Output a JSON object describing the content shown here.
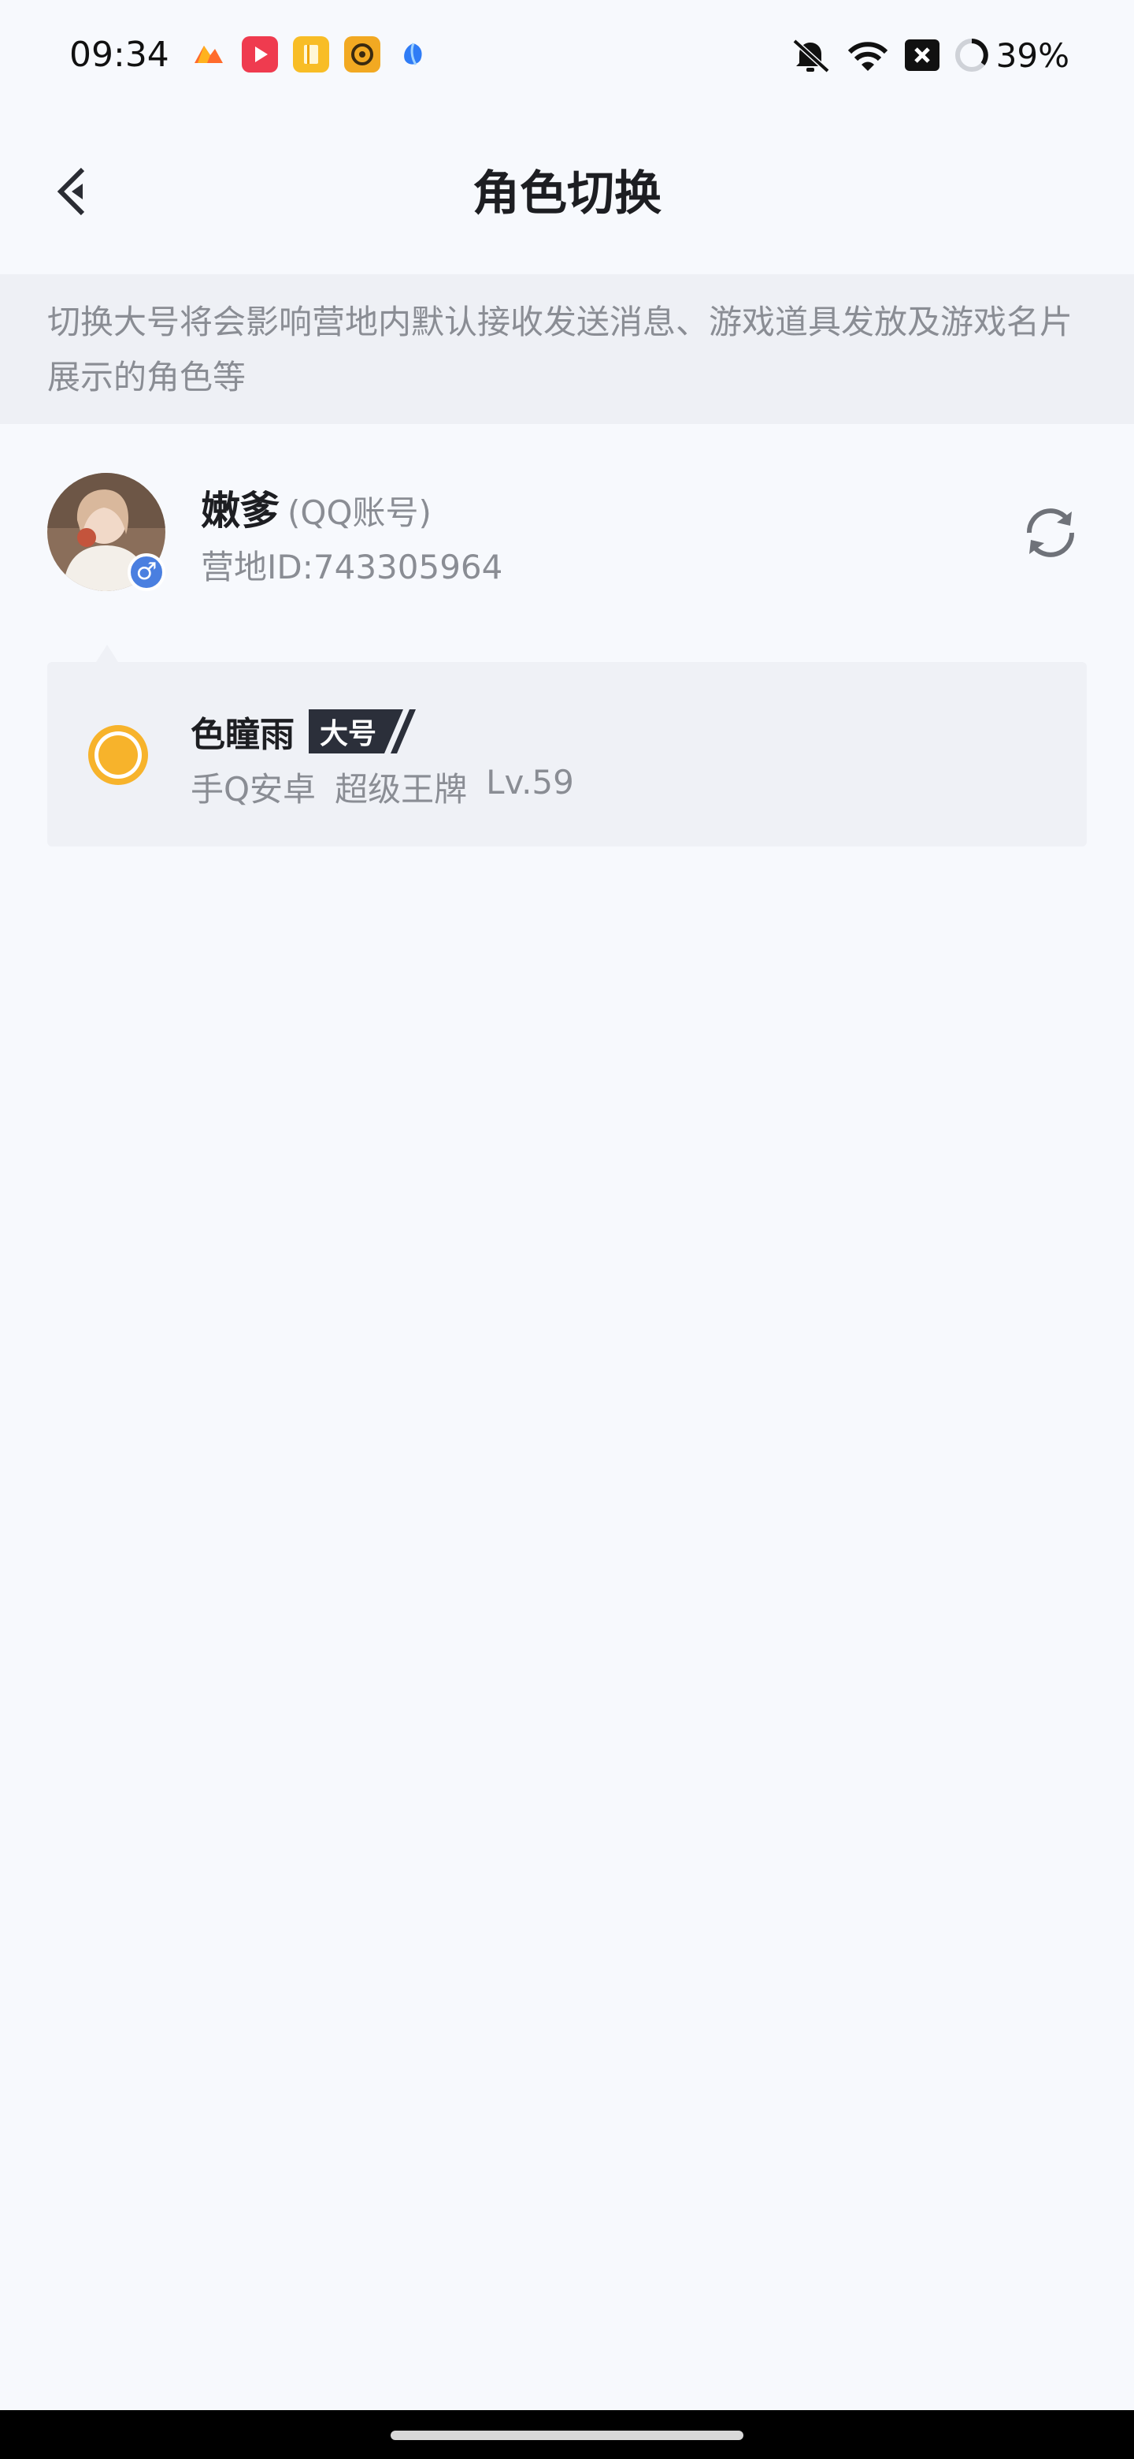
{
  "status_bar": {
    "time": "09:34",
    "app_icons": [
      "app-icon-1",
      "video-icon",
      "book-icon",
      "music-icon",
      "app-icon-5"
    ],
    "system_icons": [
      "mute-icon",
      "wifi-icon",
      "close-box-icon",
      "battery-ring-icon"
    ],
    "battery": "39%"
  },
  "nav": {
    "title": "角色切换",
    "back_icon": "chevron-left-icon"
  },
  "notice": {
    "text": "切换大号将会影响营地内默认接收发送消息、游戏道具发放及游戏名片展示的角色等"
  },
  "account": {
    "name": "嫩爹",
    "type": "(QQ账号)",
    "id": "营地ID:743305964",
    "gender_symbol": "♂",
    "refresh_icon": "refresh-icon"
  },
  "role": {
    "name": "色瞳雨",
    "tag": "大号",
    "platform": "手Q安卓",
    "rank": "超级王牌",
    "level": "Lv.59",
    "selected": true
  },
  "colors": {
    "background": "#f7f9fd",
    "notice_bg": "#eef0f5",
    "card_bg": "#eff1f6",
    "accent": "#f7b32b",
    "tag_bg": "#2b2f3a",
    "gender_badge": "#4a7fe0"
  }
}
